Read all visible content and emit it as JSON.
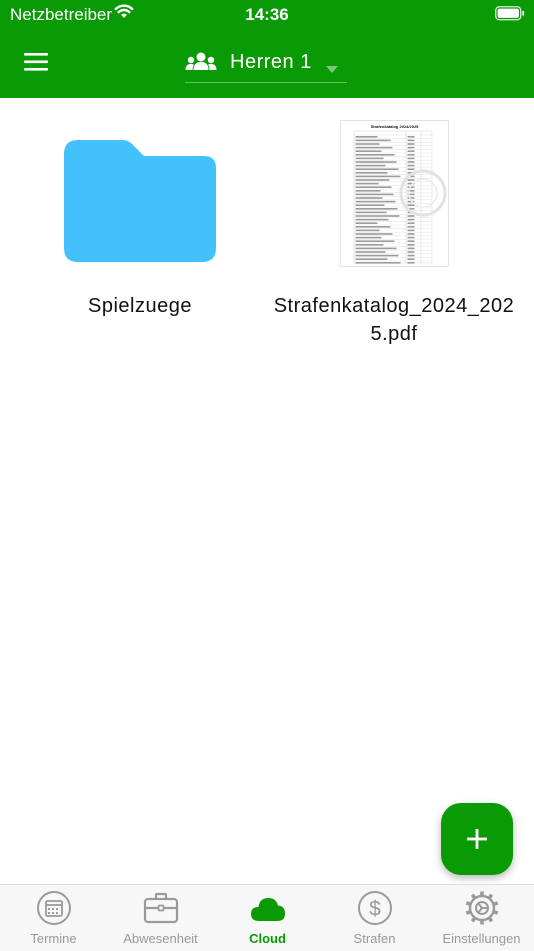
{
  "status_bar": {
    "carrier": "Netzbetreiber",
    "time": "14:36"
  },
  "header": {
    "team_name": "Herren 1"
  },
  "files": [
    {
      "name": "Spielzuege",
      "type": "folder"
    },
    {
      "name": "Strafenkatalog_2024_2025.pdf",
      "type": "pdf"
    }
  ],
  "pdf_preview": {
    "title": "Strafenkatalog 2024/2025"
  },
  "tabs": [
    {
      "label": "Termine",
      "icon": "calendar-icon"
    },
    {
      "label": "Abwesenheit",
      "icon": "briefcase-icon"
    },
    {
      "label": "Cloud",
      "icon": "cloud-icon",
      "active": true
    },
    {
      "label": "Strafen",
      "icon": "dollar-icon"
    },
    {
      "label": "Einstellungen",
      "icon": "gear-icon"
    }
  ],
  "colors": {
    "brand": "#0a9a06",
    "folder": "#42c1fd",
    "tab_inactive": "#999999",
    "tab_background": "#f7f7f7"
  }
}
